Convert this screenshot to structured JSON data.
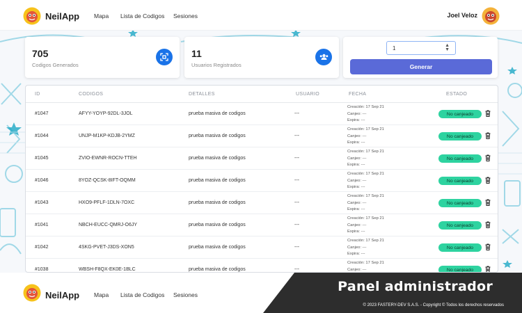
{
  "nav": {
    "brand": "NeilApp",
    "links": [
      "Mapa",
      "Lista de Codigos",
      "Sesiones"
    ],
    "user_name": "Joel Veloz"
  },
  "stats": [
    {
      "value": "705",
      "label": "Codigos Generados",
      "icon": "qr-scan-icon"
    },
    {
      "value": "11",
      "label": "Usuarios Registrados",
      "icon": "users-icon"
    }
  ],
  "generator": {
    "quantity": "1",
    "button_label": "Generar"
  },
  "table": {
    "headers": [
      "ID",
      "CODIGOS",
      "DETALLES",
      "USUARIO",
      "FECHA",
      "ESTADO"
    ],
    "rows": [
      {
        "id": "#1047",
        "code": "AFYY-YOYP-92DL-3JOL",
        "details": "prueba masiva de codigos",
        "user": "---",
        "fecha": [
          "Creación: 17 Sep 21",
          "Canjeo: ---",
          "Expira: ---"
        ],
        "estado": "No canjeado"
      },
      {
        "id": "#1044",
        "code": "UNJP-M1KP-KDJB-2YMZ",
        "details": "prueba masiva de codigos",
        "user": "---",
        "fecha": [
          "Creación: 17 Sep 21",
          "Canjeo: ---",
          "Expira: ---"
        ],
        "estado": "No canjeado"
      },
      {
        "id": "#1045",
        "code": "ZVIO-EWNR-ROCN-TTEH",
        "details": "prueba masiva de codigos",
        "user": "---",
        "fecha": [
          "Creación: 17 Sep 21",
          "Canjeo: ---",
          "Expira: ---"
        ],
        "estado": "No canjeado"
      },
      {
        "id": "#1046",
        "code": "8YOZ-QCSK-8IFT-OQMM",
        "details": "prueba masiva de codigos",
        "user": "---",
        "fecha": [
          "Creación: 17 Sep 21",
          "Canjeo: ---",
          "Expira: ---"
        ],
        "estado": "No canjeado"
      },
      {
        "id": "#1043",
        "code": "HXO9-PFLF-1DLN-7OXC",
        "details": "prueba masiva de codigos",
        "user": "---",
        "fecha": [
          "Creación: 17 Sep 21",
          "Canjeo: ---",
          "Expira: ---"
        ],
        "estado": "No canjeado"
      },
      {
        "id": "#1041",
        "code": "NBCH-EUCC-QMRJ-O6JY",
        "details": "prueba masiva de codigos",
        "user": "---",
        "fecha": [
          "Creación: 17 Sep 21",
          "Canjeo: ---",
          "Expira: ---"
        ],
        "estado": "No canjeado"
      },
      {
        "id": "#1042",
        "code": "4SKG-PVET-J3DS-XON5",
        "details": "prueba masiva de codigos",
        "user": "---",
        "fecha": [
          "Creación: 17 Sep 21",
          "Canjeo: ---",
          "Expira: ---"
        ],
        "estado": "No canjeado"
      },
      {
        "id": "#1038",
        "code": "WBSH-F8QX-EK0E-1BLC",
        "details": "prueba masiva de codigos",
        "user": "---",
        "fecha": [
          "Creación: 17 Sep 21",
          "Canjeo: ---",
          "Expira: ---"
        ],
        "estado": "No canjeado"
      }
    ]
  },
  "footer": {
    "brand": "NeilApp",
    "links": [
      "Mapa",
      "Lista de Codigos",
      "Sesiones"
    ],
    "banner_title": "Panel administrador",
    "copyright": "© 2023 FASTERY-DEV S.A.S. - Copyright © Todos los derechos reservados"
  },
  "colors": {
    "accent": "#1a73e8",
    "button": "#5a6ad8",
    "badge": "#2ed3a0",
    "doodle": "#2aa7c7"
  }
}
